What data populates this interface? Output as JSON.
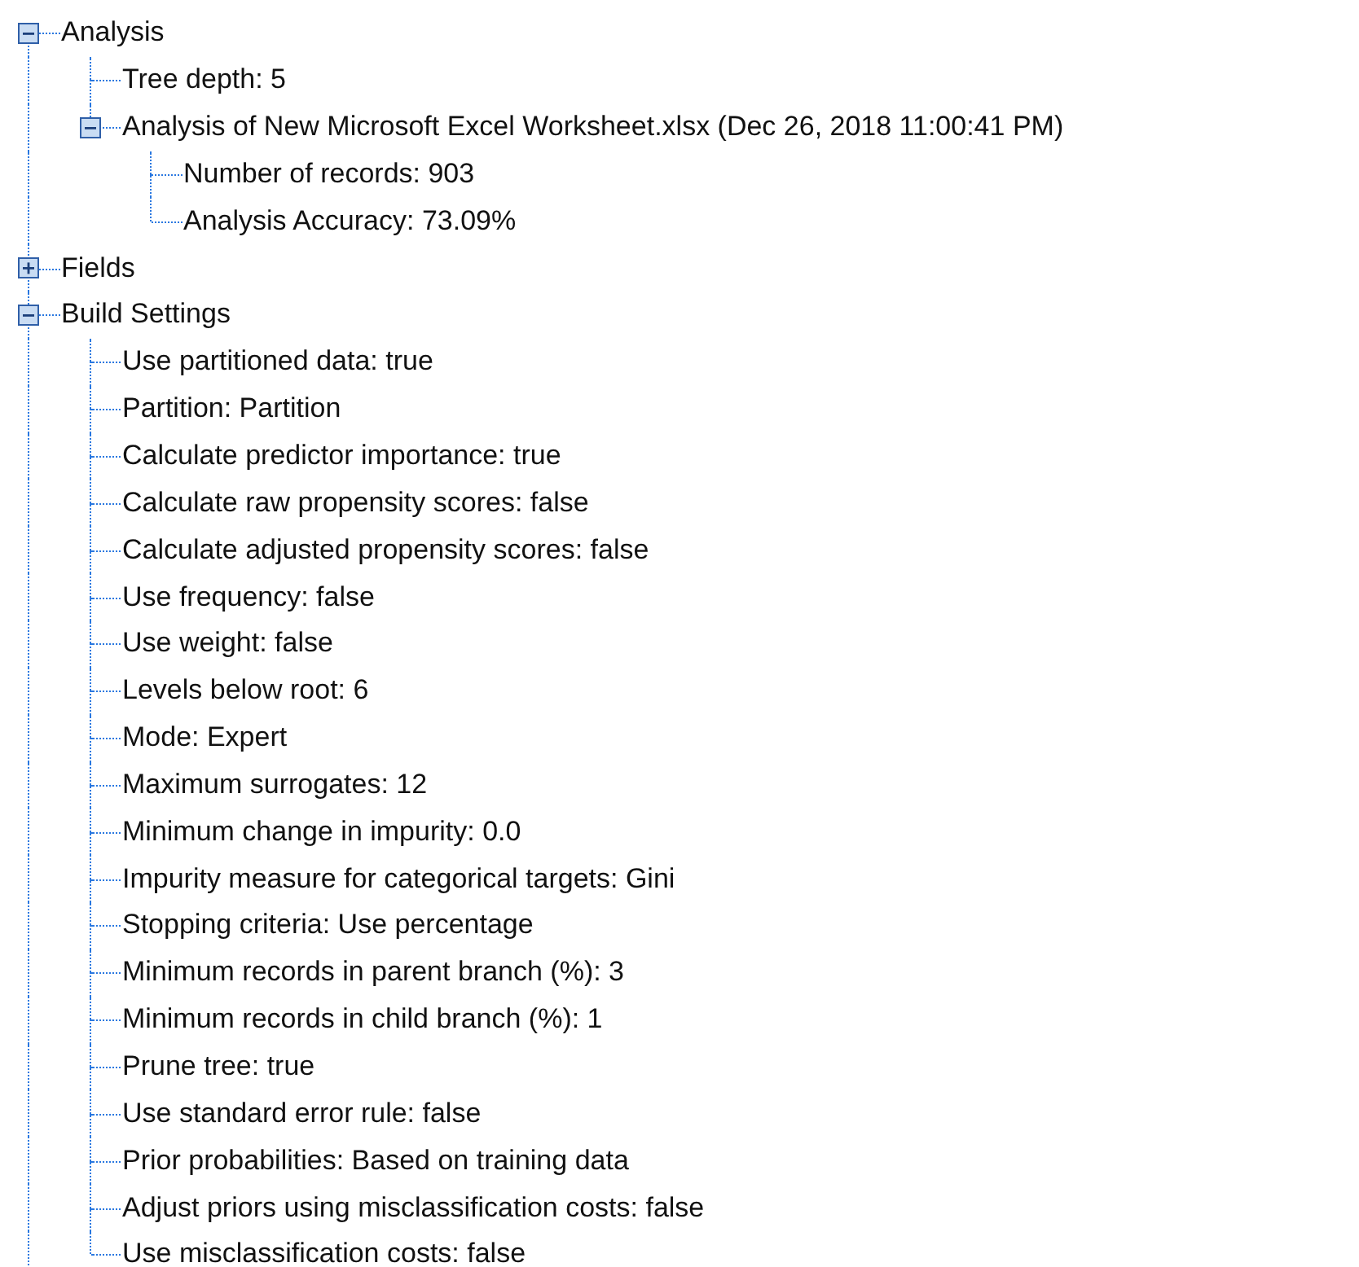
{
  "tree": [
    {
      "label": "Analysis",
      "expanded": true,
      "children": [
        {
          "label": "Tree depth: 5"
        },
        {
          "label": "Analysis of New Microsoft Excel Worksheet.xlsx (Dec 26, 2018 11:00:41 PM)",
          "expanded": true,
          "children": [
            {
              "label": "Number of records: 903"
            },
            {
              "label": "Analysis Accuracy: 73.09%"
            }
          ]
        }
      ]
    },
    {
      "label": "Fields",
      "expanded": false
    },
    {
      "label": "Build Settings",
      "expanded": true,
      "children": [
        {
          "label": "Use partitioned data: true"
        },
        {
          "label": "Partition: Partition"
        },
        {
          "label": "Calculate predictor importance: true"
        },
        {
          "label": "Calculate raw propensity scores: false"
        },
        {
          "label": "Calculate adjusted propensity scores: false"
        },
        {
          "label": "Use frequency: false"
        },
        {
          "label": "Use weight: false"
        },
        {
          "label": "Levels below root: 6"
        },
        {
          "label": "Mode: Expert"
        },
        {
          "label": "Maximum surrogates: 12"
        },
        {
          "label": "Minimum change in impurity: 0.0"
        },
        {
          "label": "Impurity measure for categorical targets: Gini"
        },
        {
          "label": "Stopping criteria: Use percentage"
        },
        {
          "label": "Minimum records in parent branch (%): 3"
        },
        {
          "label": "Minimum records in child branch (%): 1"
        },
        {
          "label": "Prune tree: true"
        },
        {
          "label": "Use standard error rule: false"
        },
        {
          "label": "Prior probabilities: Based on training data"
        },
        {
          "label": "Adjust priors using misclassification costs: false"
        },
        {
          "label": "Use misclassification costs: false"
        }
      ]
    }
  ]
}
